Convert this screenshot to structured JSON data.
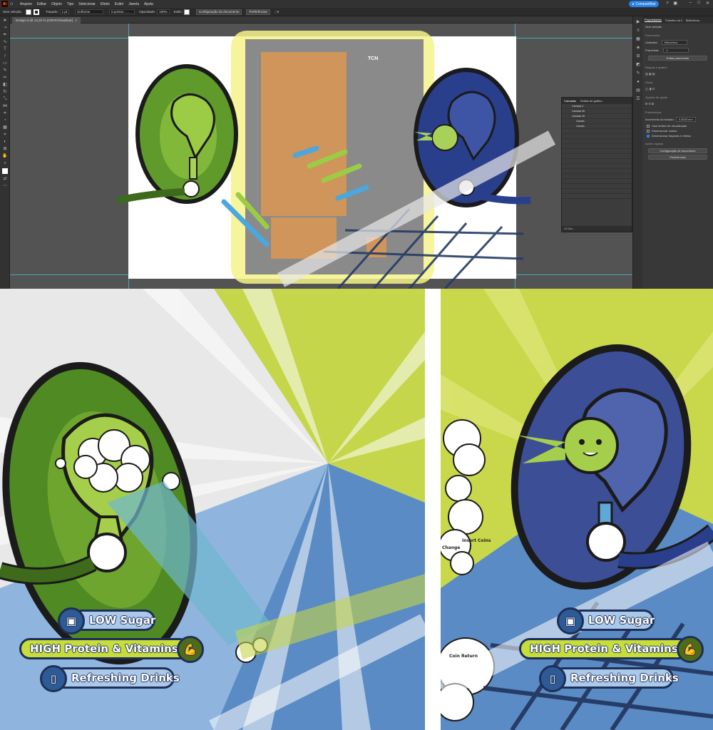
{
  "menubar": {
    "app_logo": "Ai",
    "items": [
      "Arquivo",
      "Editar",
      "Objeto",
      "Tipo",
      "Selecionar",
      "Efeito",
      "Exibir",
      "Janela",
      "Ajuda"
    ],
    "share_label": "Compartilhar"
  },
  "controlbar": {
    "selection_label": "Sem seleção",
    "stroke_label": "Traçado:",
    "stroke_value": "1 pt",
    "profile_label": "Uniforme",
    "brush_label": "5 pontos - ...",
    "opacity_label": "Opacidade:",
    "opacity_value": "100%",
    "style_label": "Estilo:",
    "doc_setup_button": "Configuração do documento",
    "prefs_button": "Preferências"
  },
  "document_tab": {
    "title": "Design.ai @ 14,22 % (CMYK/Visualizar)",
    "close": "×"
  },
  "canvas": {
    "brand_text": "TCN"
  },
  "layers_panel": {
    "tabs": [
      "Camadas",
      "Estilos de gráfico"
    ],
    "layers": [
      "Camada 2",
      "Camada 46",
      "Camada 25",
      "Camad...",
      "Camad...",
      "",
      "",
      "",
      "",
      "",
      "",
      "",
      "",
      "",
      "",
      "",
      "",
      "",
      ""
    ],
    "footer": "19 Cam..."
  },
  "properties_panel": {
    "tabs": [
      "Propriedades",
      "Trabalho da li",
      "Bibliotecas"
    ],
    "no_selection": "Sem seleção",
    "document_section": "Documento",
    "units_label": "Unidades",
    "units_value": "Milímetros",
    "artboard_label": "Prancheta:",
    "artboard_value": "1",
    "edit_artboards_button": "Editar pranchetas",
    "rulers_grids_section": "Réguas e grades",
    "guides_section": "Guias",
    "snap_section": "Opções de ajuste",
    "preferences_section": "Preferências",
    "keyboard_increment_label": "Incremento do teclado:",
    "keyboard_increment_value": "0,3528 mm",
    "checkboxes": [
      {
        "label": "Usar limites de visualização",
        "checked": false
      },
      {
        "label": "Dimensionar cantos",
        "checked": false
      },
      {
        "label": "Dimensionar traçados e efeitos",
        "checked": true
      }
    ],
    "quick_actions_section": "Ações rápidas",
    "doc_setup_button": "Configuração de documento",
    "prefs_button": "Preferências"
  },
  "left_mockup": {
    "pills": [
      {
        "label": "LOW Sugar",
        "icon": "cubes-icon"
      },
      {
        "label": "HIGH Protein & Vitamins",
        "icon": "muscle-icon"
      },
      {
        "label": "Refreshing Drinks",
        "icon": "can-icon"
      }
    ]
  },
  "right_mockup": {
    "pills": [
      {
        "label": "LOW Sugar",
        "icon": "cubes-icon"
      },
      {
        "label": "HIGH Protein & Vitamins",
        "icon": "muscle-icon"
      },
      {
        "label": "Refreshing Drinks",
        "icon": "can-icon"
      }
    ],
    "change_label": "Change",
    "insert_coins_label": "Insert Coins",
    "coin_return_label": "Coin Return"
  },
  "colors": {
    "accent_blue": "#2680eb",
    "green_dark": "#4f6b1a",
    "lime": "#c6dd3a",
    "navy": "#1e2f57",
    "racket_blue": "#3c4f96"
  }
}
